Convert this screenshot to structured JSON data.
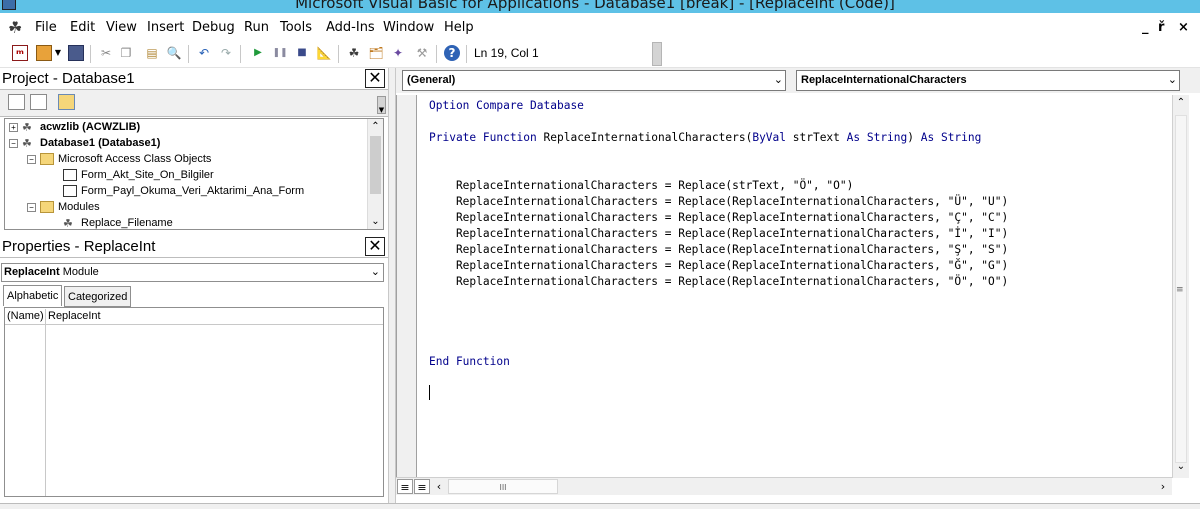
{
  "window": {
    "title": "Microsoft Visual Basic for Applications - Database1 [break] - [ReplaceInt (Code)]"
  },
  "menu": {
    "items": [
      "File",
      "Edit",
      "View",
      "Insert",
      "Debug",
      "Run",
      "Tools",
      "Add-Ins",
      "Window",
      "Help"
    ],
    "window_controls": [
      "_",
      "ř",
      "×"
    ]
  },
  "toolbar": {
    "position_status": "Ln 19, Col 1",
    "icons": [
      "access-icon",
      "insert-module-icon",
      "save-icon",
      "cut-icon",
      "copy-icon",
      "paste-icon",
      "find-icon",
      "undo-icon",
      "redo-icon",
      "run-icon",
      "break-icon",
      "reset-icon",
      "design-mode-icon",
      "project-explorer-icon",
      "properties-icon",
      "object-browser-icon",
      "toolbox-icon",
      "help-icon"
    ]
  },
  "project": {
    "title": "Project - Database1",
    "tree": [
      {
        "label": "acwzlib (ACWZLIB)",
        "bold": true
      },
      {
        "label": "Database1 (Database1)",
        "bold": true
      },
      {
        "label": "Microsoft Access Class Objects",
        "bold": false
      },
      {
        "label": "Form_Akt_Site_On_Bilgiler",
        "bold": false
      },
      {
        "label": "Form_Payl_Okuma_Veri_Aktarimi_Ana_Form",
        "bold": false
      },
      {
        "label": "Modules",
        "bold": false
      },
      {
        "label": "Replace_Filename",
        "bold": false
      }
    ]
  },
  "properties": {
    "title": "Properties - ReplaceInt",
    "object_name": "ReplaceInt",
    "object_type": "Module",
    "tabs": [
      "Alphabetic",
      "Categorized"
    ],
    "rows": [
      {
        "name": "(Name)",
        "value": "ReplaceInt"
      }
    ]
  },
  "code": {
    "object_combo": "(General)",
    "procedure_combo": "ReplaceInternationalCharacters",
    "lines": [
      "Option Compare Database",
      "",
      "Private Function ReplaceInternationalCharacters(ByVal strText As String) As String",
      "",
      "",
      "    ReplaceInternationalCharacters = Replace(strText, \"Ö\", \"O\")",
      "    ReplaceInternationalCharacters = Replace(ReplaceInternationalCharacters, \"Ü\", \"U\")",
      "    ReplaceInternationalCharacters = Replace(ReplaceInternationalCharacters, \"Ç\", \"C\")",
      "    ReplaceInternationalCharacters = Replace(ReplaceInternationalCharacters, \"İ\", \"I\")",
      "    ReplaceInternationalCharacters = Replace(ReplaceInternationalCharacters, \"Ş\", \"S\")",
      "    ReplaceInternationalCharacters = Replace(ReplaceInternationalCharacters, \"Ğ\", \"G\")",
      "    ReplaceInternationalCharacters = Replace(ReplaceInternationalCharacters, \"Ö\", \"O\")",
      "",
      "",
      "",
      "",
      "End Function"
    ]
  },
  "colors": {
    "titlebar": "#5ec1e6",
    "keyword": "#00008b"
  }
}
